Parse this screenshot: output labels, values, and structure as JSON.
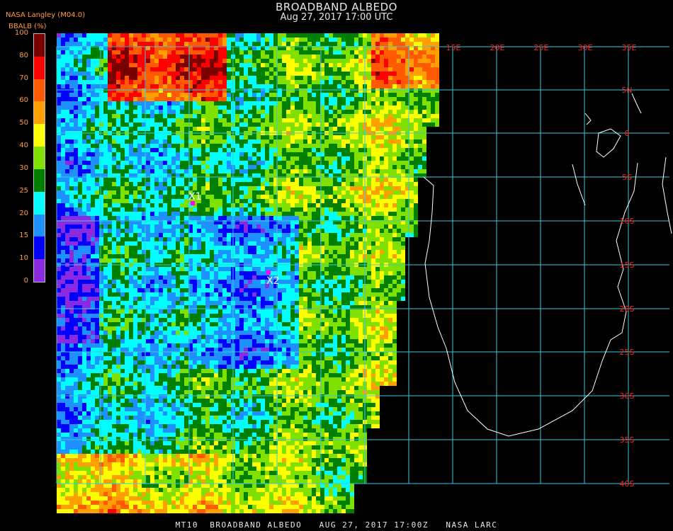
{
  "header": {
    "title": "BROADBAND ALBEDO",
    "subtitle": "Aug 27, 2017 17:00 UTC",
    "producer": "NASA Langley (M04.0)"
  },
  "colorbar": {
    "label": "BBALB (%)",
    "ticks": [
      "100",
      "80",
      "70",
      "60",
      "50",
      "40",
      "30",
      "25",
      "20",
      "15",
      "10",
      "0"
    ],
    "colors": [
      "#7a0000",
      "#ff0000",
      "#ff5a00",
      "#ffa000",
      "#ffff00",
      "#80e000",
      "#008000",
      "#00ffff",
      "#1e90ff",
      "#0000ff",
      "#8a2be2"
    ]
  },
  "map": {
    "lon_labels": [
      "15E",
      "20E",
      "25E",
      "30E",
      "35E"
    ],
    "lat_labels": [
      "5N",
      "0",
      "5S",
      "10S",
      "15S",
      "20S",
      "25S",
      "30S",
      "35S",
      "40S"
    ],
    "markers": [
      {
        "label": "X1",
        "color": "#ff00ff"
      },
      {
        "label": "X2",
        "color": "#ff00ff"
      }
    ],
    "grid_color": "#3cc8dc",
    "label_color": "#ff2020"
  },
  "footer": {
    "text": "MT10  BROADBAND ALBEDO   AUG 27, 2017 17:00Z   NASA LARC"
  }
}
